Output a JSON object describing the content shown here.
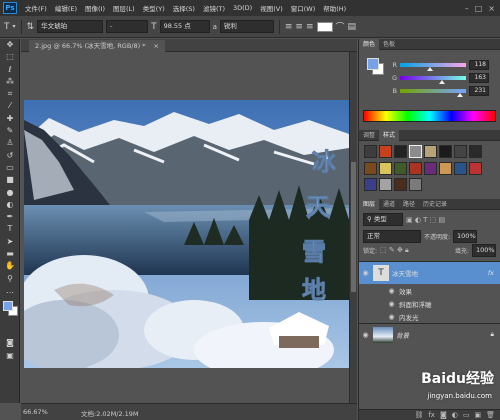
{
  "menubar": {
    "logo": "Ps",
    "items": [
      "文件(F)",
      "编辑(E)",
      "图像(I)",
      "图层(L)",
      "类型(Y)",
      "选择(S)",
      "滤镜(T)",
      "3D(D)",
      "视图(V)",
      "窗口(W)",
      "帮助(H)"
    ],
    "window_controls": [
      "–",
      "□",
      "×"
    ]
  },
  "options": {
    "font_family": "华文琥珀",
    "font_style": "-",
    "font_size": "98.55 点",
    "aa_label": "a",
    "antialias": "锐利"
  },
  "document": {
    "tab_title": "2.jpg @ 66.7% (冰天雪地, RGB/8) *",
    "close": "×",
    "artwork_text": "冰天雪地"
  },
  "status": {
    "zoom": "66.67%",
    "doc_info": "文档:2.02M/2.19M"
  },
  "color_panel": {
    "tabs": [
      "颜色",
      "色板"
    ],
    "channels": [
      {
        "label": "R",
        "value": "118",
        "level": 0.46
      },
      {
        "label": "G",
        "value": "163",
        "level": 0.64
      },
      {
        "label": "B",
        "value": "231",
        "level": 0.91
      }
    ]
  },
  "styles_panel": {
    "tabs": [
      "调整",
      "样式"
    ]
  },
  "layers_panel": {
    "tabs": [
      "图层",
      "通道",
      "路径",
      "历史记录"
    ],
    "filter_label": "类型",
    "blend_mode": "正常",
    "opacity_label": "不透明度:",
    "opacity": "100%",
    "lock_label": "锁定:",
    "fill_label": "填充:",
    "fill": "100%",
    "layers": [
      {
        "name": "冰天雪地",
        "kind": "text",
        "fx": "fx"
      },
      {
        "name": "效果",
        "kind": "effects-group"
      },
      {
        "name": "斜面和浮雕",
        "kind": "effect"
      },
      {
        "name": "内发光",
        "kind": "effect"
      },
      {
        "name": "背景",
        "kind": "background"
      }
    ]
  },
  "watermark": {
    "brand": "Baidu经验",
    "url": "jingyan.baidu.com"
  },
  "colors": {
    "accent": "#5a8fcf",
    "panel_bg": "#535353",
    "foreground_swatch": "#76a3e7"
  }
}
